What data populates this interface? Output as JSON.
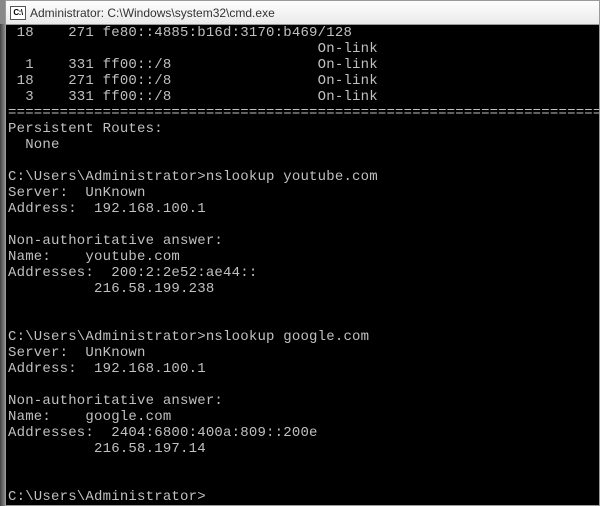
{
  "titlebar": {
    "icon_label": "C:\\",
    "title": "Administrator: C:\\Windows\\system32\\cmd.exe"
  },
  "terminal": {
    "lines": [
      " 18    271 fe80::4885:b16d:3170:b469/128",
      "                                    On-link",
      "  1    331 ff00::/8                 On-link",
      " 18    271 ff00::/8                 On-link",
      "  3    331 ff00::/8                 On-link",
      "===========================================================================",
      "Persistent Routes:",
      "  None",
      "",
      "C:\\Users\\Administrator>nslookup youtube.com",
      "Server:  UnKnown",
      "Address:  192.168.100.1",
      "",
      "Non-authoritative answer:",
      "Name:    youtube.com",
      "Addresses:  200:2:2e52:ae44::",
      "          216.58.199.238",
      "",
      "",
      "C:\\Users\\Administrator>nslookup google.com",
      "Server:  UnKnown",
      "Address:  192.168.100.1",
      "",
      "Non-authoritative answer:",
      "Name:    google.com",
      "Addresses:  2404:6800:400a:809::200e",
      "          216.58.197.14",
      "",
      "",
      "C:\\Users\\Administrator>"
    ]
  }
}
